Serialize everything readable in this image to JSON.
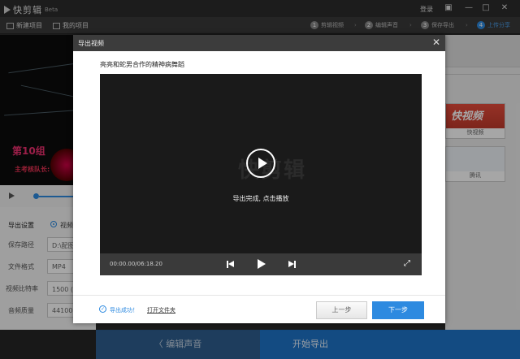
{
  "app": {
    "name": "快剪辑",
    "badge": "Beta",
    "login": "登录"
  },
  "window_controls": {
    "skin": "▣",
    "minimize": "—",
    "maximize": "□",
    "close": "✕"
  },
  "toolbar": {
    "new_project": "新建项目",
    "my_projects": "我的项目",
    "steps": [
      {
        "num": "1",
        "label": "剪辑视频"
      },
      {
        "num": "2",
        "label": "编辑声音"
      },
      {
        "num": "3",
        "label": "保存导出"
      },
      {
        "num": "4",
        "label": "上传分享"
      }
    ]
  },
  "preview": {
    "text1": "第10组",
    "text2": "主考核队长:"
  },
  "settings": {
    "export_settings_label": "导出设置",
    "export_option": "视频",
    "save_path_label": "保存路径",
    "save_path_value": "D:\\配图",
    "format_label": "文件格式",
    "format_value": "MP4",
    "bitrate_label": "视频比特率",
    "bitrate_value": "1500 (标",
    "audio_label": "音频质量",
    "audio_value": "44100H"
  },
  "right_panel": {
    "card1_brand": "快视频",
    "card1_label": "快视频",
    "card2_label": "腾讯"
  },
  "bottom": {
    "prev": "〈  编辑声音",
    "next": "开始导出"
  },
  "dialog": {
    "title": "导出视频",
    "close": "✕",
    "video_title": "亮亮和蛇男合作的精神病舞蹈",
    "watermark": "快剪辑",
    "message": "导出完成, 点击播放",
    "time": "00:00.00/06:18.20",
    "fullscreen": "⤢",
    "success_text": "导出成功！",
    "success_icon": "✓",
    "open_folder": "打开文件夹",
    "prev_button": "上一步",
    "next_button": "下一步"
  },
  "colors": {
    "accent": "#2d8ae0",
    "dialog_header": "#3c3c3c",
    "video_bg": "#1a1a1a",
    "control_bar": "#3a3a3a"
  }
}
